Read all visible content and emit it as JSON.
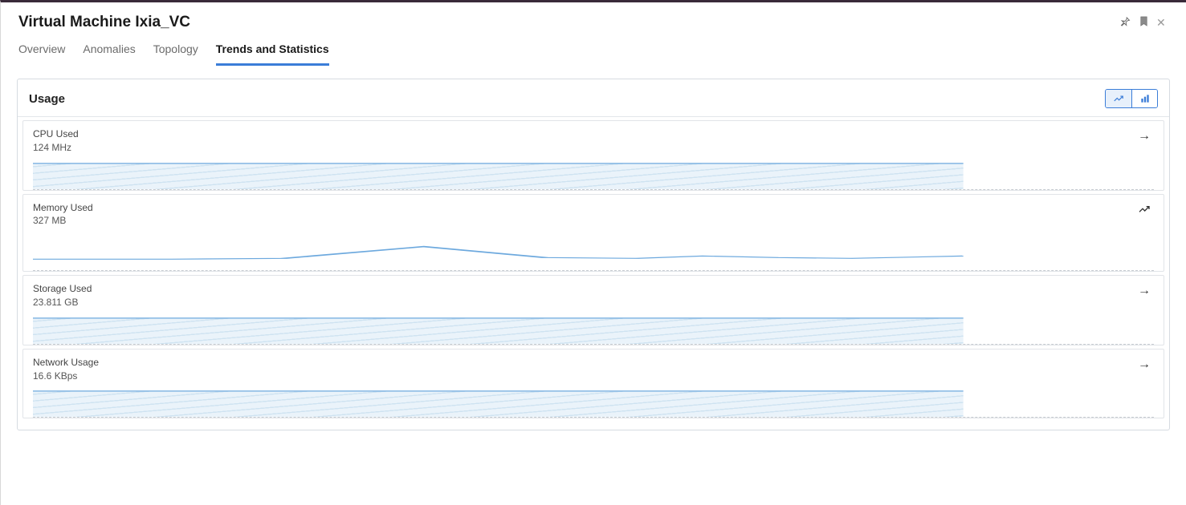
{
  "header": {
    "title": "Virtual Machine Ixia_VC"
  },
  "tabs": [
    {
      "label": "Overview",
      "active": false
    },
    {
      "label": "Anomalies",
      "active": false
    },
    {
      "label": "Topology",
      "active": false
    },
    {
      "label": "Trends and Statistics",
      "active": true
    }
  ],
  "panel": {
    "title": "Usage",
    "view_mode": "line"
  },
  "metrics": [
    {
      "label": "CPU Used",
      "value": "124 MHz",
      "trend": "flat"
    },
    {
      "label": "Memory Used",
      "value": "327 MB",
      "trend": "up"
    },
    {
      "label": "Storage Used",
      "value": "23.811 GB",
      "trend": "flat"
    },
    {
      "label": "Network Usage",
      "value": "16.6 KBps",
      "trend": "flat"
    }
  ],
  "chart_data": [
    {
      "type": "area",
      "title": "CPU Used",
      "ylabel": "MHz",
      "x": [
        0,
        1,
        2,
        3,
        4,
        5,
        6,
        7,
        8,
        9
      ],
      "values": [
        124,
        124,
        124,
        124,
        124,
        124,
        124,
        124,
        124,
        124
      ],
      "ylim": [
        0,
        150
      ]
    },
    {
      "type": "line",
      "title": "Memory Used",
      "ylabel": "MB",
      "x": [
        0,
        1,
        2,
        3,
        4,
        5,
        6,
        7,
        8,
        9
      ],
      "values": [
        320,
        320,
        322,
        325,
        345,
        330,
        322,
        328,
        326,
        322,
        328
      ],
      "ylim": [
        300,
        360
      ]
    },
    {
      "type": "area",
      "title": "Storage Used",
      "ylabel": "GB",
      "x": [
        0,
        1,
        2,
        3,
        4,
        5,
        6,
        7,
        8,
        9
      ],
      "values": [
        23.81,
        23.81,
        23.81,
        23.81,
        23.81,
        23.81,
        23.81,
        23.81,
        23.81,
        23.81
      ],
      "ylim": [
        0,
        30
      ]
    },
    {
      "type": "area",
      "title": "Network Usage",
      "ylabel": "KBps",
      "x": [
        0,
        1,
        2,
        3,
        4,
        5,
        6,
        7,
        8,
        9
      ],
      "values": [
        16.6,
        16.6,
        16.6,
        16.6,
        16.6,
        16.6,
        16.6,
        16.6,
        16.6,
        16.6
      ],
      "ylim": [
        0,
        20
      ]
    }
  ]
}
